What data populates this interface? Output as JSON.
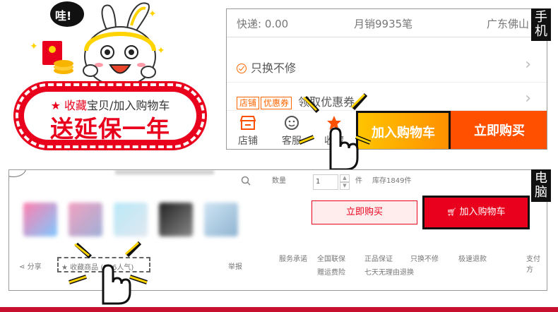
{
  "promo": {
    "star": "★",
    "line1_red": "收藏",
    "line1_black": "宝贝/加入购物车",
    "line2": "送延保一年",
    "bubble": "哇!"
  },
  "phone": {
    "side_label_1": "手",
    "side_label_2": "机",
    "shipping": "快递: 0.00",
    "monthly_sales": "月销9935笔",
    "location": "广东佛山",
    "promise": "只换不修",
    "tag_shop": "店铺",
    "tag_coupon": "优惠券",
    "coupon_text": "领取优惠券",
    "chevron": "›",
    "bar": {
      "shop_label": "店铺",
      "service_label": "客服",
      "favorite_label": "收藏",
      "cart_button": "加入购物车",
      "buy_button": "立即购买"
    }
  },
  "pc": {
    "side_label_1": "电",
    "side_label_2": "脑",
    "quantity_label": "数量",
    "quantity_value": "1",
    "unit": "件",
    "stock": "库存1849件",
    "buy_button": "立即购买",
    "cart_button": "加入购物车",
    "share": "分享",
    "favorite": "收藏商品",
    "popularity": "(916人气)",
    "report": "举报",
    "service_label": "服务承诺",
    "services": [
      "全国联保",
      "正品保证",
      "只换不修",
      "极速退款",
      "支付方"
    ],
    "services_row2": [
      "赠运费险",
      "七天无理由退换"
    ]
  },
  "colors": {
    "accent_red": "#e8001c",
    "orange": "#ff5000",
    "yellow": "#ffc400"
  }
}
